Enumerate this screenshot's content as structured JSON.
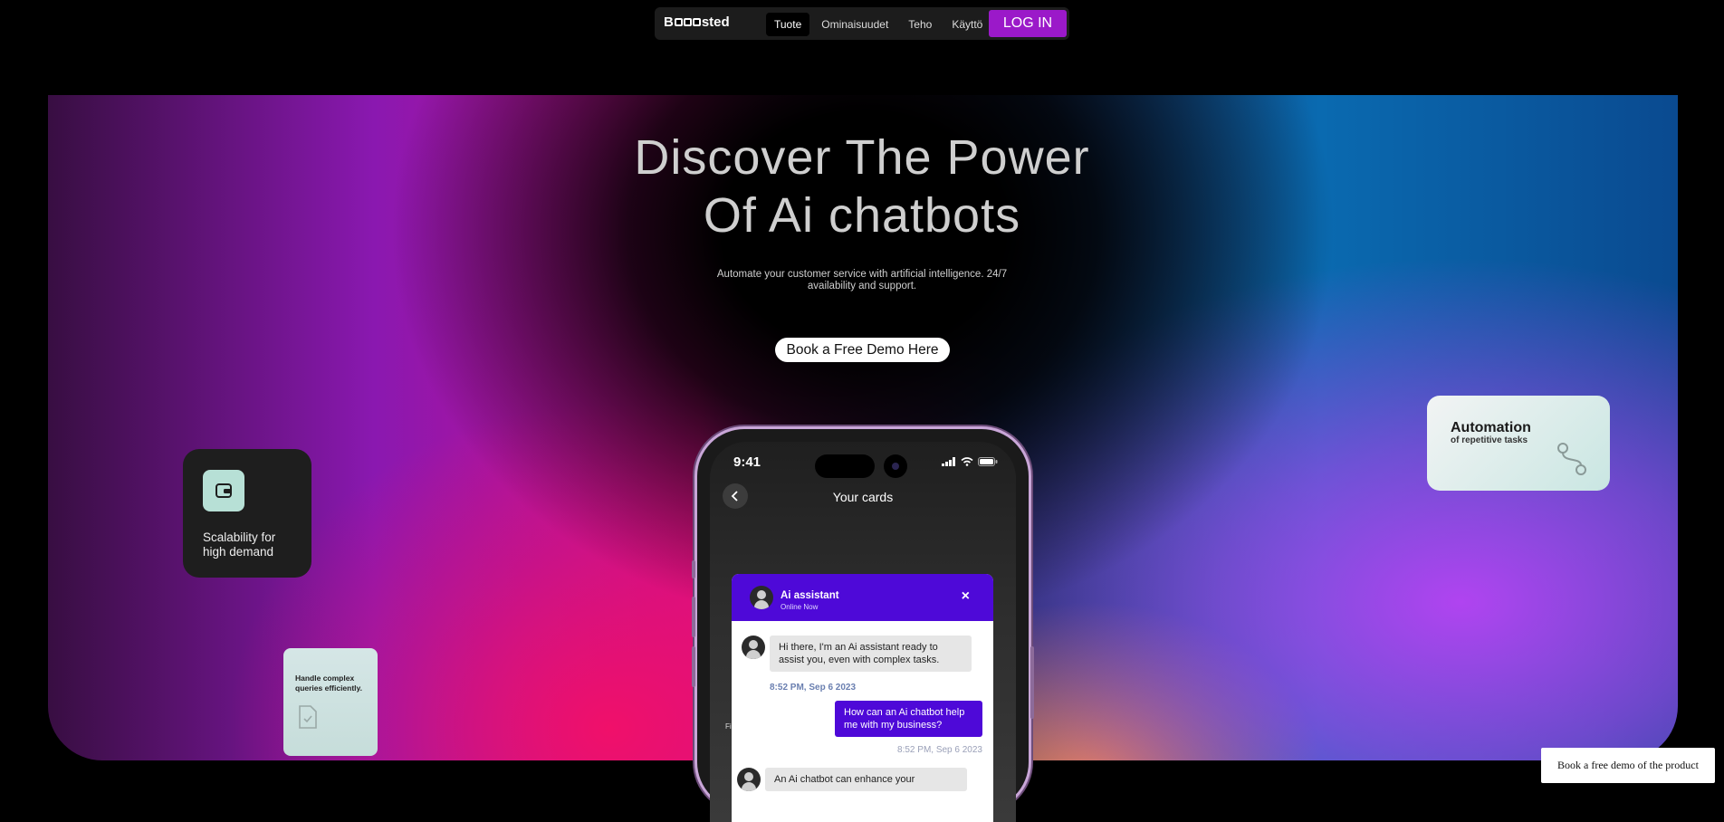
{
  "nav": {
    "logo_prefix": "B",
    "logo_suffix": "sted",
    "links": [
      "Tuote",
      "Ominaisuudet",
      "Teho",
      "Käyttö"
    ],
    "active_link": "Tuote",
    "login_label": "LOG IN"
  },
  "hero": {
    "title_line1": "Discover The Power",
    "title_line2": "Of Ai chatbots",
    "subtitle": "Automate your customer service with artificial intelligence. 24/7 availability and support.",
    "demo_button": "Book a Free Demo Here"
  },
  "cards": {
    "scalability": "Scalability for high demand",
    "automation_title": "Automation",
    "automation_sub": "of repetitive tasks",
    "handle": "Handle complex queries efficiently."
  },
  "phone": {
    "time": "9:41",
    "screen_title": "Your cards",
    "stray_text": "Fi"
  },
  "chat": {
    "name": "Ai assistant",
    "status": "Online Now",
    "close": "×",
    "messages": [
      {
        "from": "bot",
        "text": "Hi there, I'm an Ai assistant ready to assist you, even with complex tasks.",
        "time": "8:52 PM, Sep 6 2023"
      },
      {
        "from": "user",
        "text": "How can an Ai chatbot help me with my business?",
        "time": "8:52 PM, Sep 6 2023"
      },
      {
        "from": "bot",
        "text": "An Ai chatbot can enhance your"
      }
    ]
  },
  "floating_button": "Book a free demo of the product",
  "colors": {
    "brand_purple": "#9b19c9",
    "chat_purple": "#4e09d8",
    "nav_bg": "#1c1c1c"
  },
  "icons": [
    "wallet-icon",
    "route-icon",
    "document-check-icon",
    "back-chevron-icon",
    "signal-icon",
    "wifi-icon",
    "battery-icon",
    "close-icon"
  ]
}
